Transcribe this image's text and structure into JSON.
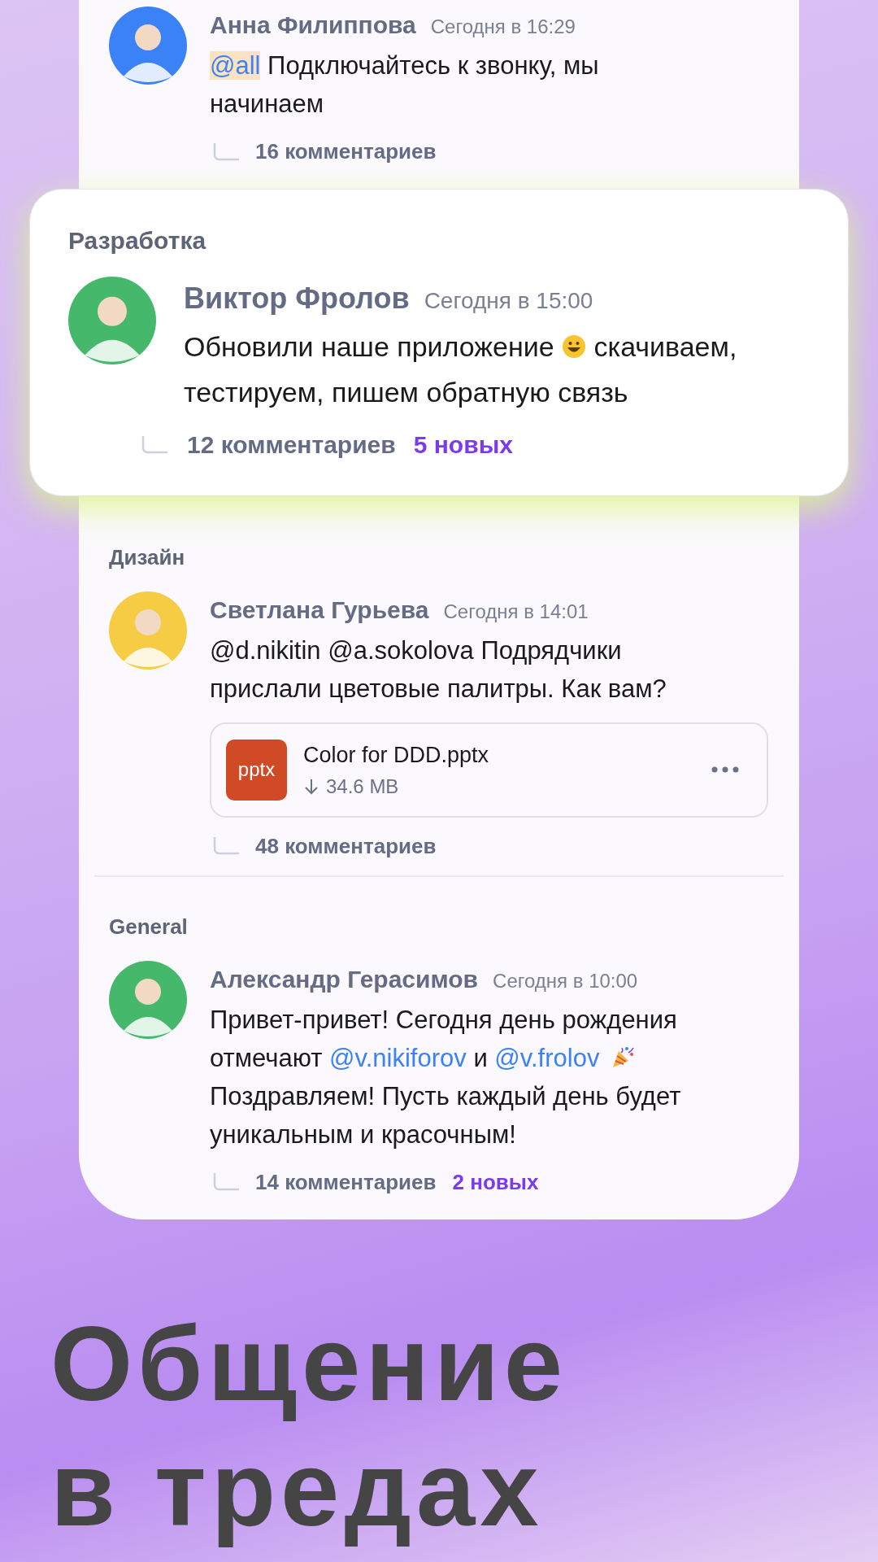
{
  "threads": [
    {
      "highlighted": false,
      "author": "Анна Филиппова",
      "time": "Сегодня в 16:29",
      "avatar": {
        "color": "#3b82f6"
      },
      "parts": [
        {
          "kind": "tag",
          "text": "@all"
        },
        {
          "kind": "text",
          "text": " Подключайтесь к звонку, мы начинаем"
        }
      ],
      "comments": "16 комментариев"
    },
    {
      "highlighted": true,
      "channel": "Разработка",
      "author": "Виктор Фролов",
      "time": "Сегодня в 15:00",
      "avatar": {
        "color": "#45b86b"
      },
      "parts": [
        {
          "kind": "text",
          "text": "Обновили наше приложение "
        },
        {
          "kind": "smiley"
        },
        {
          "kind": "text",
          "text": " скачиваем, тестируем, пишем обратную связь"
        }
      ],
      "comments": "12 комментариев",
      "new": "5 новых"
    },
    {
      "highlighted": false,
      "channel": "Дизайн",
      "author": "Светлана Гурьева",
      "time": "Сегодня в 14:01",
      "avatar": {
        "color": "#f7cc45"
      },
      "parts": [
        {
          "kind": "text",
          "text": "@d.nikitin @a.sokolova Подрядчики прислали цветовые палитры. Как вам?"
        }
      ],
      "attachment": {
        "badge": "pptx",
        "name": "Color for DDD.pptx",
        "size": "34.6 MB"
      },
      "comments": "48 комментариев"
    },
    {
      "highlighted": false,
      "channel": "General",
      "author": "Александр Герасимов",
      "time": "Сегодня в 10:00",
      "avatar": {
        "color": "#45b86b"
      },
      "parts": [
        {
          "kind": "text",
          "text": "Привет-привет! Сегодня день рождения отмечают "
        },
        {
          "kind": "mention",
          "text": "@v.nikiforov"
        },
        {
          "kind": "text",
          "text": " и "
        },
        {
          "kind": "mention",
          "text": "@v.frolov"
        },
        {
          "kind": "party"
        },
        {
          "kind": "text",
          "text": " Поздравляем! Пусть каждый день будет уникальным и красочным!"
        }
      ],
      "comments": "14 комментариев",
      "new": "2 новых"
    }
  ],
  "headline_lines": [
    "Общение",
    "в тредах"
  ]
}
